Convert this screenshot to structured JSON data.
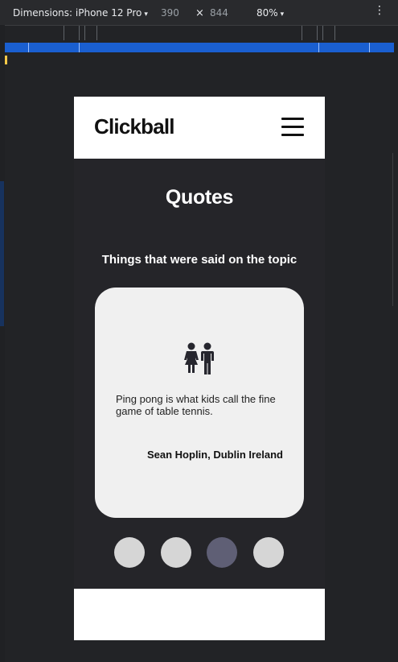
{
  "devtools": {
    "device_label": "Dimensions: iPhone 12 Pro",
    "width": "390",
    "times": "×",
    "height": "844",
    "zoom": "80%",
    "more_icon": "⋮",
    "caret_icon": "▾"
  },
  "site": {
    "logo": "Clickball",
    "menu_icon": "hamburger-icon"
  },
  "quotes": {
    "title": "Quotes",
    "subtitle": "Things that were said on the topic",
    "card": {
      "icon": "children-icon",
      "text": "Ping pong is what kids call the fine game of table tennis.",
      "author": "Sean Hoplin, Dublin Ireland"
    },
    "dots_count": 4,
    "active_dot": 3
  },
  "colors": {
    "accent_blue": "#1a5fd0",
    "card_bg": "#f0f0f0",
    "page_bg": "#252529",
    "active_dot": "#5f5f75",
    "inactive_dot": "#d6d6d6"
  }
}
